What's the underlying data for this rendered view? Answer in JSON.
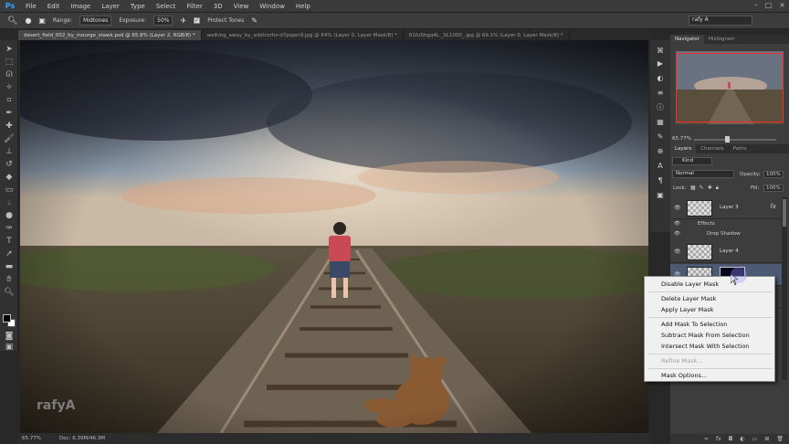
{
  "app": {
    "logo": "Ps"
  },
  "menu": [
    "File",
    "Edit",
    "Image",
    "Layer",
    "Type",
    "Select",
    "Filter",
    "3D",
    "View",
    "Window",
    "Help"
  ],
  "window_controls": [
    "–",
    "□",
    "×"
  ],
  "options": {
    "range_label": "Range:",
    "range_value": "Midtones",
    "exposure_label": "Exposure:",
    "exposure_value": "50%",
    "protect_tones": "Protect Tones",
    "workspace": "rafy A"
  },
  "tabs": [
    {
      "label": "desert_field_002_by_mourge_stawk.psd @ 65.8% (Layer 2, RGB/8) *",
      "active": true
    },
    {
      "label": "walking_away_by_addicortiz-d7pigen9.jpg @ 64% (Layer 0, Layer Mask/8) *",
      "active": false
    },
    {
      "label": "61fuShgq4L._SL1000_.jpg @ 69.1% (Layer 0, Layer Mask/8) *",
      "active": false
    }
  ],
  "status": {
    "zoom": "65.77%",
    "doc": "Doc: 6.39M/46.3M"
  },
  "watermark": "rafyA",
  "navigator": {
    "tabs": [
      "Navigator",
      "Histogram"
    ],
    "zoom": "65.77%"
  },
  "layers_panel": {
    "tabs": [
      "Layers",
      "Channels",
      "Paths"
    ],
    "kind": "Kind",
    "blend_mode": "Normal",
    "opacity_label": "Opacity:",
    "opacity_value": "100%",
    "lock_label": "Lock:",
    "fill_label": "Fill:",
    "fill_value": "100%",
    "layers": [
      {
        "name": "Layer 3",
        "fx": "fx"
      },
      {
        "name": "Layer 4"
      }
    ],
    "effects_label": "Effects",
    "drop_shadow_label": "Drop Shadow"
  },
  "context_menu": {
    "items": [
      {
        "label": "Disable Layer Mask",
        "disabled": false
      },
      {
        "label": "Delete Layer Mask",
        "disabled": false
      },
      {
        "label": "Apply Layer Mask",
        "disabled": false
      },
      {
        "label": "Add Mask To Selection",
        "disabled": false
      },
      {
        "label": "Subtract Mask From Selection",
        "disabled": false
      },
      {
        "label": "Intersect Mask With Selection",
        "disabled": false
      },
      {
        "label": "Refine Mask...",
        "disabled": true
      },
      {
        "label": "Mask Options...",
        "disabled": false
      }
    ]
  }
}
